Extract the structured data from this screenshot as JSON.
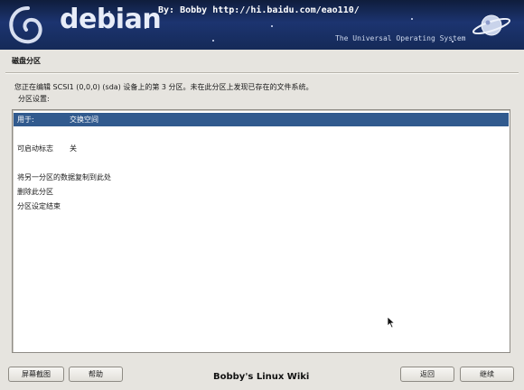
{
  "banner": {
    "logo_text": "debian",
    "byline": "By: Bobby  http://hi.baidu.com/eao110/",
    "tagline": "The Universal Operating System"
  },
  "page": {
    "title": "磁盘分区",
    "intro": "您正在编辑 SCSI1 (0,0,0) (sda) 设备上的第 3 分区。未在此分区上发现已存在的文件系统。",
    "settings_label": "分区设置:"
  },
  "partition_settings": [
    {
      "label": "用于:",
      "value": "交换空间",
      "selected": true
    },
    {
      "label": "可启动标志",
      "value": "关",
      "selected": false
    }
  ],
  "actions": [
    {
      "label": "将另一分区的数据复制到此处"
    },
    {
      "label": "删除此分区"
    },
    {
      "label": "分区设定结束"
    }
  ],
  "buttons": {
    "screenshot": "屏幕截图",
    "help": "帮助",
    "back": "返回",
    "continue": "继续"
  },
  "footer": {
    "text": "Bobby's Linux Wiki"
  },
  "colors": {
    "selection": "#315a8e",
    "banner": "#1c3470",
    "window_bg": "#e6e4df"
  }
}
